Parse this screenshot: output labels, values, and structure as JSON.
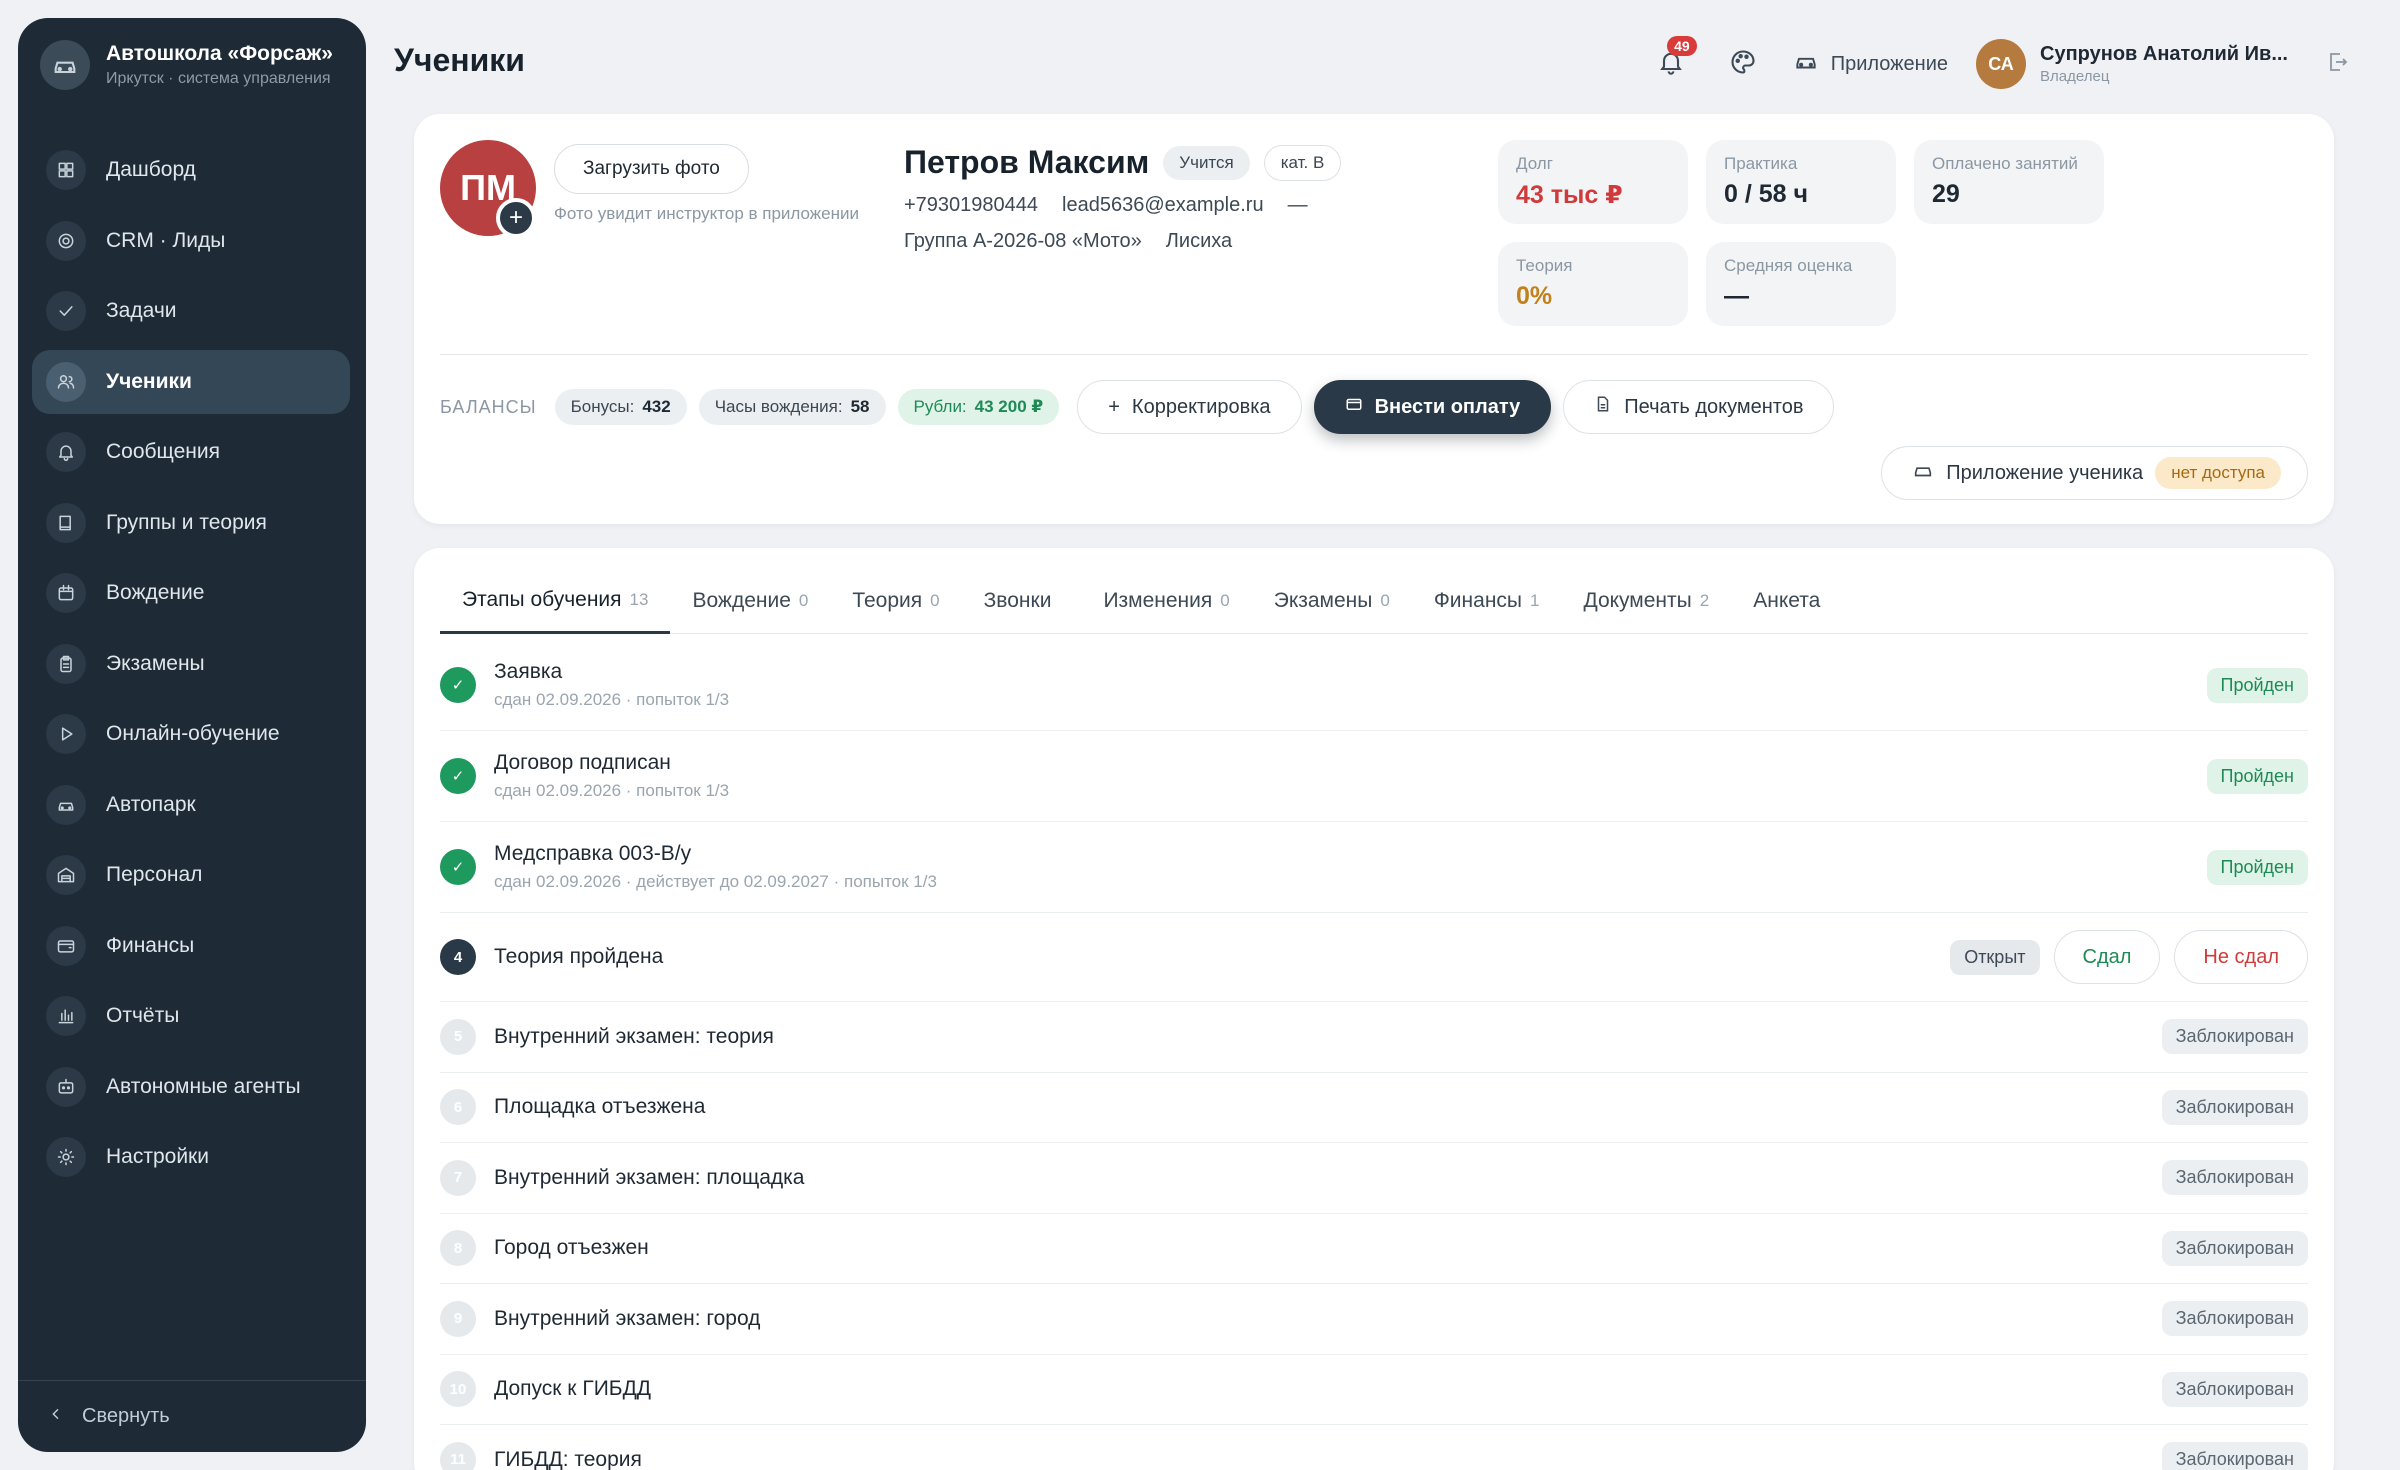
{
  "brand": {
    "title": "Автошкола «Форсаж»",
    "subtitle": "Иркутск · система управления"
  },
  "nav": [
    {
      "label": "Дашборд",
      "icon": "grid-icon"
    },
    {
      "label": "CRM · Лиды",
      "icon": "target-icon"
    },
    {
      "label": "Задачи",
      "icon": "check-icon"
    },
    {
      "label": "Ученики",
      "icon": "users-icon",
      "active": true
    },
    {
      "label": "Сообщения",
      "icon": "bell-icon"
    },
    {
      "label": "Группы и теория",
      "icon": "book-icon"
    },
    {
      "label": "Вождение",
      "icon": "calendar-icon"
    },
    {
      "label": "Экзамены",
      "icon": "clipboard-icon"
    },
    {
      "label": "Онлайн-обучение",
      "icon": "play-icon"
    },
    {
      "label": "Автопарк",
      "icon": "car-icon"
    },
    {
      "label": "Персонал",
      "icon": "garage-icon"
    },
    {
      "label": "Финансы",
      "icon": "wallet-icon"
    },
    {
      "label": "Отчёты",
      "icon": "bar-chart-icon"
    },
    {
      "label": "Автономные агенты",
      "icon": "bot-icon"
    },
    {
      "label": "Настройки",
      "icon": "sun-gear-icon"
    }
  ],
  "collapse_label": "Свернуть",
  "page_title": "Ученики",
  "topbar": {
    "notifications_count": "49",
    "app_label": "Приложение",
    "user_initials": "СА",
    "user_name": "Супрунов Анатолий Ив...",
    "user_role": "Владелец"
  },
  "student": {
    "initials": "ПМ",
    "upload_label": "Загрузить фото",
    "upload_hint": "Фото увидит инструктор в приложении",
    "name": "Петров Максим",
    "status": "Учится",
    "category": "кат. B",
    "phone": "+79301980444",
    "email": "lead5636@example.ru",
    "dash": "—",
    "group": "Группа А-2026-08 «Мото»",
    "instructor": "Лисиха"
  },
  "stats": [
    {
      "label": "Долг",
      "value": "43 тыс ₽",
      "color": "#d03a3a"
    },
    {
      "label": "Практика",
      "value": "0 / 58 ч",
      "color": "#1f2933"
    },
    {
      "label": "Оплачено занятий",
      "value": "29",
      "color": "#1f2933"
    },
    {
      "label": "Теория",
      "value": "0%",
      "color": "#c4801a"
    },
    {
      "label": "Средняя оценка",
      "value": "—",
      "color": "#1f2933"
    }
  ],
  "balances": {
    "label": "БАЛАНСЫ",
    "bonus_label": "Бонусы:",
    "bonus_value": "432",
    "hours_label": "Часы вождения:",
    "hours_value": "58",
    "rub_label": "Рубли:",
    "rub_value": "43 200 ₽"
  },
  "actions": {
    "adjust": "Корректировка",
    "pay": "Внести оплату",
    "print": "Печать документов",
    "app_access": "Приложение ученика",
    "no_access": "нет доступа"
  },
  "tabs": [
    {
      "label": "Этапы обучения",
      "count": "13",
      "active": true
    },
    {
      "label": "Вождение",
      "count": "0"
    },
    {
      "label": "Теория",
      "count": "0"
    },
    {
      "label": "Звонки",
      "count": ""
    },
    {
      "label": "Изменения",
      "count": "0"
    },
    {
      "label": "Экзамены",
      "count": "0"
    },
    {
      "label": "Финансы",
      "count": "1"
    },
    {
      "label": "Документы",
      "count": "2"
    },
    {
      "label": "Анкета",
      "count": ""
    }
  ],
  "stages": [
    {
      "num": "✓",
      "state": "done",
      "title": "Заявка",
      "sub": "сдан 02.09.2026 · попыток 1/3",
      "status": "Пройден"
    },
    {
      "num": "✓",
      "state": "done",
      "title": "Договор подписан",
      "sub": "сдан 02.09.2026 · попыток 1/3",
      "status": "Пройден"
    },
    {
      "num": "✓",
      "state": "done",
      "title": "Медсправка 003-В/у",
      "sub": "сдан 02.09.2026 · действует до 02.09.2027 · попыток 1/3",
      "status": "Пройден"
    },
    {
      "num": "4",
      "state": "cur",
      "title": "Теория пройдена",
      "sub": "",
      "status": "Открыт",
      "pass_btn": "Сдал",
      "fail_btn": "Не сдал"
    },
    {
      "num": "5",
      "state": "lock",
      "title": "Внутренний экзамен: теория",
      "sub": "",
      "status": "Заблокирован"
    },
    {
      "num": "6",
      "state": "lock",
      "title": "Площадка отъезжена",
      "sub": "",
      "status": "Заблокирован"
    },
    {
      "num": "7",
      "state": "lock",
      "title": "Внутренний экзамен: площадка",
      "sub": "",
      "status": "Заблокирован"
    },
    {
      "num": "8",
      "state": "lock",
      "title": "Город отъезжен",
      "sub": "",
      "status": "Заблокирован"
    },
    {
      "num": "9",
      "state": "lock",
      "title": "Внутренний экзамен: город",
      "sub": "",
      "status": "Заблокирован"
    },
    {
      "num": "10",
      "state": "lock",
      "title": "Допуск к ГИБДД",
      "sub": "",
      "status": "Заблокирован"
    },
    {
      "num": "11",
      "state": "lock",
      "title": "ГИБДД: теория",
      "sub": "",
      "status": "Заблокирован"
    }
  ]
}
